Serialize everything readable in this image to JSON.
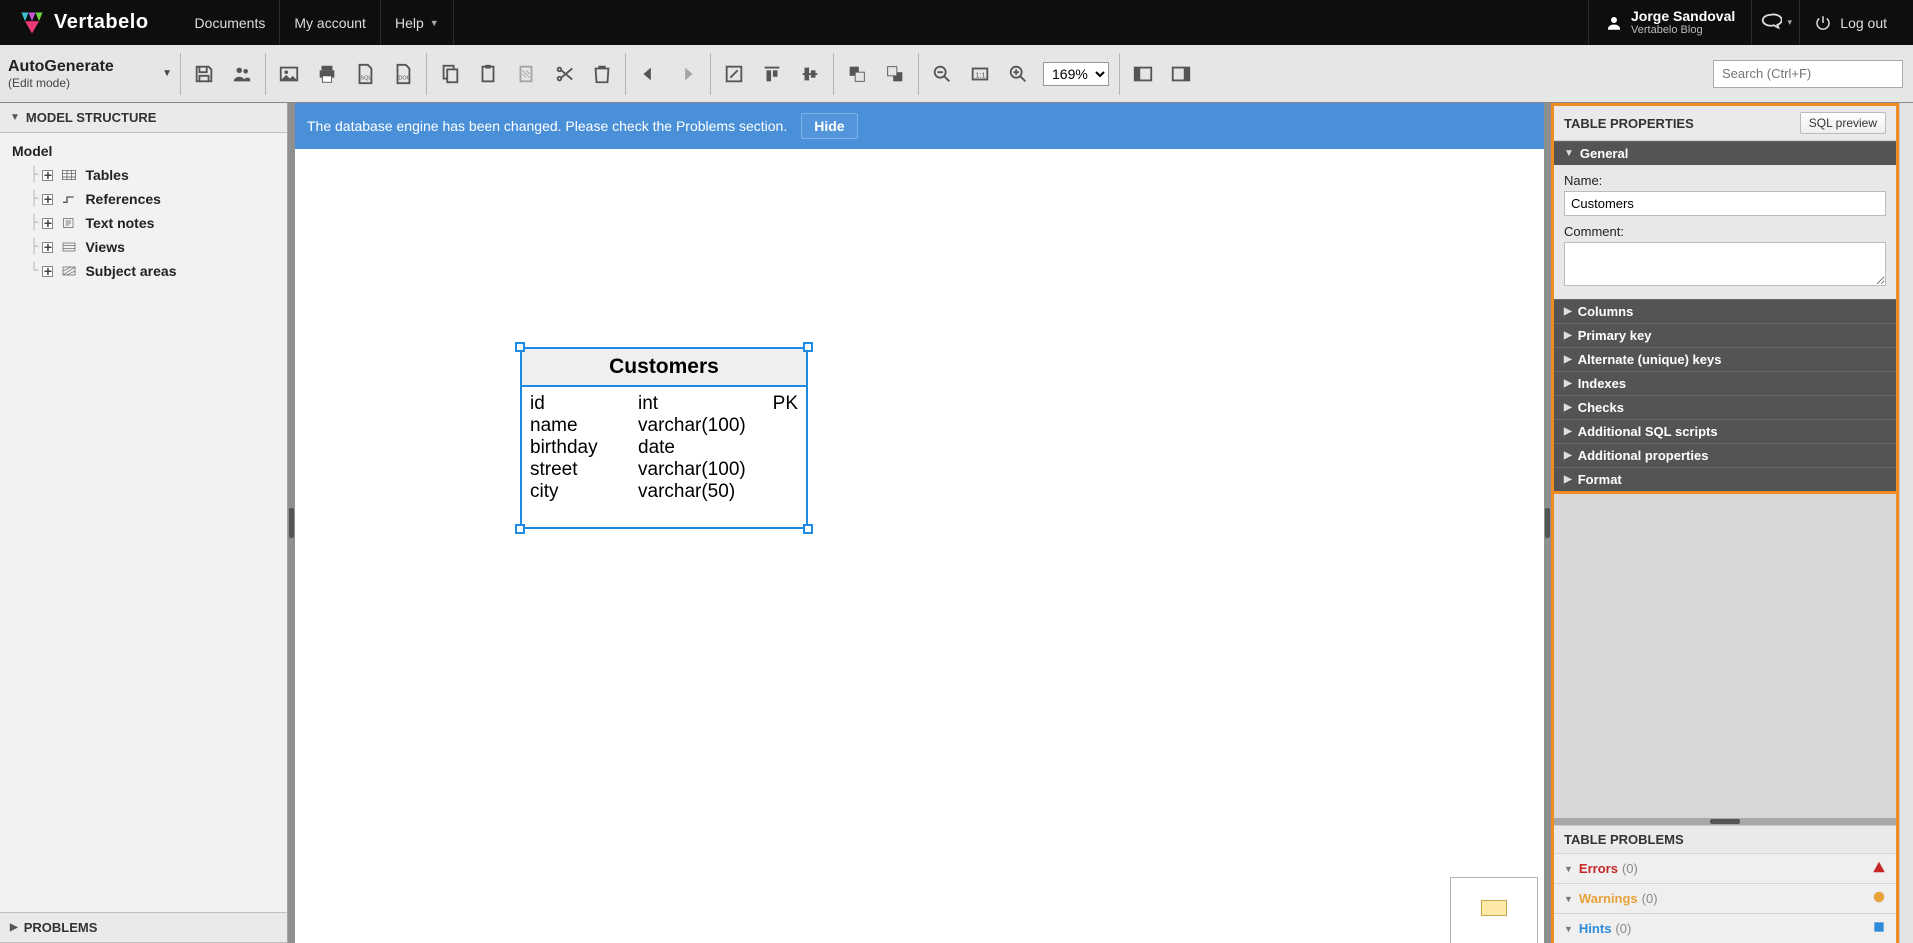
{
  "brand": "Vertabelo",
  "topnav": {
    "documents": "Documents",
    "my_account": "My account",
    "help": "Help"
  },
  "user": {
    "name": "Jorge Sandoval",
    "sub": "Vertabelo Blog"
  },
  "logout": "Log out",
  "doc": {
    "title": "AutoGenerate",
    "mode": "(Edit mode)"
  },
  "zoom": "169%",
  "search_placeholder": "Search (Ctrl+F)",
  "left": {
    "head": "MODEL STRUCTURE",
    "root": "Model",
    "items": [
      "Tables",
      "References",
      "Text notes",
      "Views",
      "Subject areas"
    ],
    "problems": "PROBLEMS"
  },
  "notice": {
    "text": "The database engine has been changed. Please check the Problems section.",
    "hide": "Hide"
  },
  "entity": {
    "name": "Customers",
    "rows": [
      {
        "name": "id",
        "type": "int",
        "key": "PK"
      },
      {
        "name": "name",
        "type": "varchar(100)",
        "key": ""
      },
      {
        "name": "birthday",
        "type": "date",
        "key": ""
      },
      {
        "name": "street",
        "type": "varchar(100)",
        "key": ""
      },
      {
        "name": "city",
        "type": "varchar(50)",
        "key": ""
      }
    ]
  },
  "right": {
    "head": "TABLE PROPERTIES",
    "sql_preview": "SQL preview",
    "general": "General",
    "name_label": "Name:",
    "name_value": "Customers",
    "comment_label": "Comment:",
    "sections": [
      "Columns",
      "Primary key",
      "Alternate (unique) keys",
      "Indexes",
      "Checks",
      "Additional SQL scripts",
      "Additional properties",
      "Format"
    ],
    "problems_head": "TABLE PROBLEMS",
    "errors": "Errors",
    "errors_n": "(0)",
    "warnings": "Warnings",
    "warnings_n": "(0)",
    "hints": "Hints",
    "hints_n": "(0)"
  }
}
